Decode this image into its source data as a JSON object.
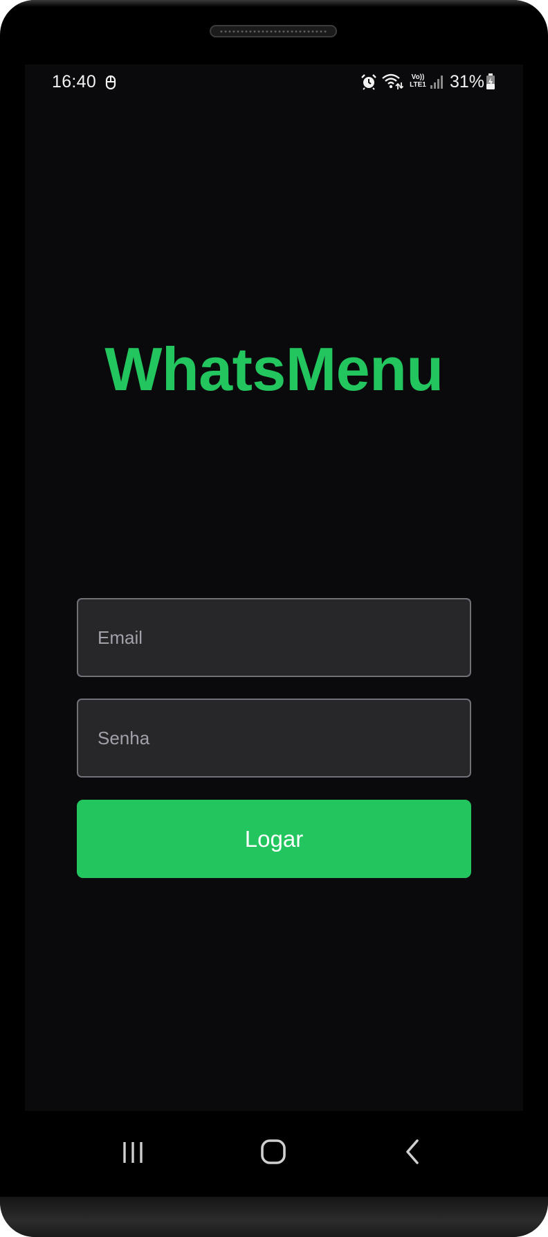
{
  "status_bar": {
    "time": "16:40",
    "battery_percent": "31%",
    "network_label_top": "Vo))",
    "network_label_bottom": "LTE1",
    "icons": [
      "sync-icon",
      "alarm-icon",
      "wifi-icon",
      "volte-lte-icon",
      "signal-icon",
      "battery-charging-icon"
    ]
  },
  "app": {
    "title": "WhatsMenu",
    "accent_color": "#22c55e"
  },
  "login_form": {
    "email_placeholder": "Email",
    "email_value": "",
    "password_placeholder": "Senha",
    "password_value": "",
    "submit_label": "Logar"
  },
  "navigation_bar": {
    "buttons": [
      "recent-apps-icon",
      "home-icon",
      "back-icon"
    ]
  }
}
